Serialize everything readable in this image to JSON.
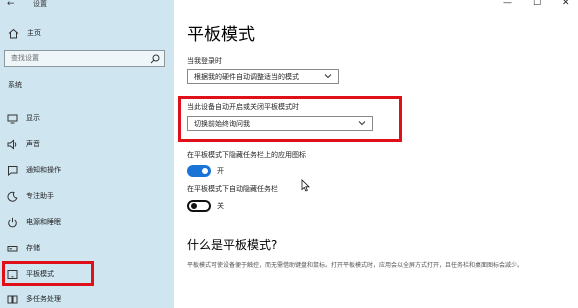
{
  "window": {
    "title": "设置",
    "controls": {
      "minimize": "—",
      "maximize": "☐",
      "close": "✕"
    }
  },
  "sidebar": {
    "home_label": "主页",
    "search_placeholder": "查找设置",
    "section_title": "系统",
    "items": [
      {
        "label": "显示",
        "icon": "monitor-icon"
      },
      {
        "label": "声音",
        "icon": "speaker-icon"
      },
      {
        "label": "通知和操作",
        "icon": "notification-icon"
      },
      {
        "label": "专注助手",
        "icon": "moon-icon"
      },
      {
        "label": "电源和睡眠",
        "icon": "power-icon"
      },
      {
        "label": "存储",
        "icon": "storage-icon"
      },
      {
        "label": "平板模式",
        "icon": "tablet-icon",
        "selected": true
      },
      {
        "label": "多任务处理",
        "icon": "multitask-icon"
      }
    ]
  },
  "main": {
    "page_title": "平板模式",
    "signin_label": "当我登录时",
    "signin_select_value": "根据我的硬件自动调整适当的模式",
    "auto_switch_label": "当此设备自动开启或关闭平板模式时",
    "auto_switch_select_value": "切换前始终询问我",
    "hide_icons_label": "在平板模式下隐藏任务栏上的应用图标",
    "hide_icons_state": "开",
    "hide_icons_on": true,
    "auto_hide_label": "在平板模式下自动隐藏任务栏",
    "auto_hide_state": "关",
    "auto_hide_on": false,
    "what_is_heading": "什么是平板模式?",
    "description": "平板模式可使设备便于触控，而无需借助键盘和鼠标。打开平板模式时，应用会以全屏方式打开，且任务栏和桌面图标会减少。"
  },
  "colors": {
    "sidebar_bg": "#cfe6f1",
    "highlight_red": "#e0101a",
    "toggle_on": "#1a73d6"
  }
}
